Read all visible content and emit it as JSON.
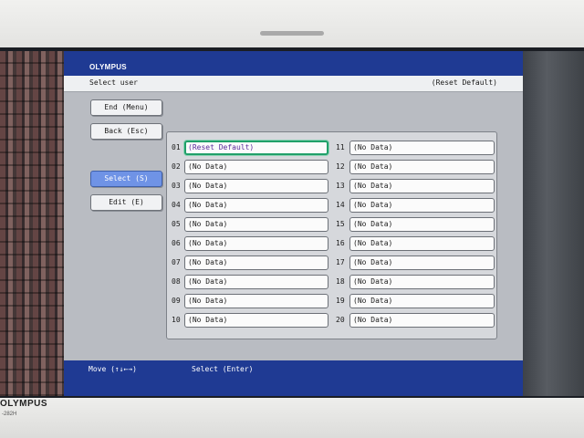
{
  "monitor": {
    "brand": "OLYMPUS",
    "model": "-282H"
  },
  "app": {
    "logo": "OLYMPUS",
    "title": "Select user",
    "current_user": "(Reset Default)"
  },
  "buttons": {
    "end": "End (Menu)",
    "back": "Back (Esc)",
    "select": "Select (S)",
    "edit": "Edit (E)"
  },
  "slots_left": [
    {
      "num": "01",
      "label": "(Reset Default)",
      "selected": true
    },
    {
      "num": "02",
      "label": "(No Data)"
    },
    {
      "num": "03",
      "label": "(No Data)"
    },
    {
      "num": "04",
      "label": "(No Data)"
    },
    {
      "num": "05",
      "label": "(No Data)"
    },
    {
      "num": "06",
      "label": "(No Data)"
    },
    {
      "num": "07",
      "label": "(No Data)"
    },
    {
      "num": "08",
      "label": "(No Data)"
    },
    {
      "num": "09",
      "label": "(No Data)"
    },
    {
      "num": "10",
      "label": "(No Data)"
    }
  ],
  "slots_right": [
    {
      "num": "11",
      "label": "(No Data)"
    },
    {
      "num": "12",
      "label": "(No Data)"
    },
    {
      "num": "13",
      "label": "(No Data)"
    },
    {
      "num": "14",
      "label": "(No Data)"
    },
    {
      "num": "15",
      "label": "(No Data)"
    },
    {
      "num": "16",
      "label": "(No Data)"
    },
    {
      "num": "17",
      "label": "(No Data)"
    },
    {
      "num": "18",
      "label": "(No Data)"
    },
    {
      "num": "19",
      "label": "(No Data)"
    },
    {
      "num": "20",
      "label": "(No Data)"
    }
  ],
  "footer": {
    "move_hint": "Move (↑↓←→)",
    "select_hint": "Select (Enter)"
  },
  "colors": {
    "header_blue": "#1f3a93",
    "active_button": "#6f93e6",
    "selection_border": "#21a06a"
  }
}
